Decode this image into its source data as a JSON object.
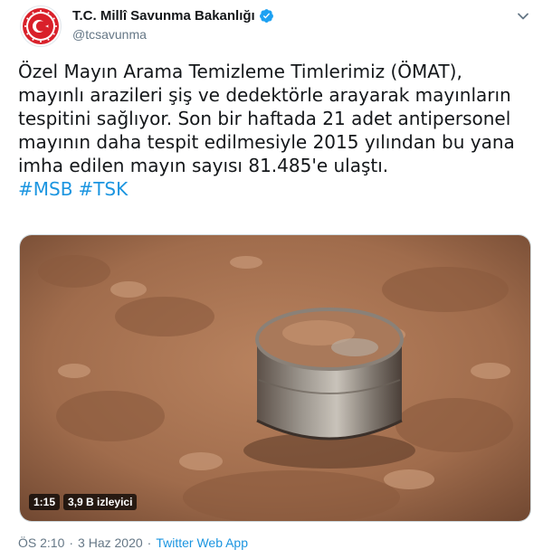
{
  "header": {
    "display_name": "T.C. Millî Savunma Bakanlığı",
    "handle": "@tcsavunma",
    "verified": true,
    "icons": {
      "avatar": "ministry-emblem-icon",
      "verified": "verified-badge-icon",
      "menu": "chevron-down-icon"
    }
  },
  "tweet": {
    "lines": [
      "Özel Mayın Arama Temizleme Timlerimiz (ÖMAT),",
      "mayınlı arazileri şiş ve dedektörle arayarak mayınların",
      "tespitini sağlıyor. Son bir haftada 21 adet antipersonel",
      "mayının daha tespit edilmesiyle 2015 yılından bu yana",
      "imha edilen mayın sayısı 81.485'e ulaştı."
    ],
    "hashtags": [
      "#MSB",
      "#TSK"
    ]
  },
  "media": {
    "duration": "1:15",
    "views": "3,9 B izleyici"
  },
  "meta": {
    "time": "ÖS 2:10",
    "separator": "·",
    "date": "3 Haz 2020",
    "source": "Twitter Web App"
  },
  "colors": {
    "link": "#1b95e0",
    "secondary_text": "#657786",
    "verified": "#1da1f2",
    "emblem_red": "#d9202a"
  }
}
